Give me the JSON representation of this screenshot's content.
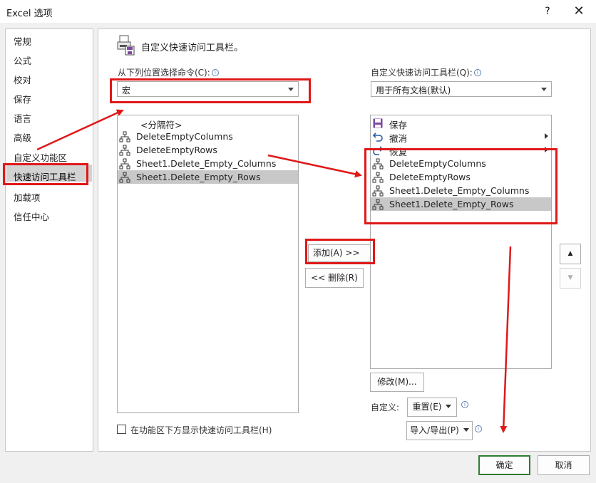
{
  "window": {
    "title": "Excel 选项",
    "help": "?",
    "close": "✕"
  },
  "nav": {
    "items": [
      "常规",
      "公式",
      "校对",
      "保存",
      "语言",
      "高级",
      "自定义功能区",
      "快速访问工具栏",
      "加载项",
      "信任中心"
    ],
    "selected_index": 7
  },
  "header": {
    "title": "自定义快速访问工具栏。"
  },
  "left": {
    "choose_label": "从下列位置选择命令(C):",
    "choose_value": "宏",
    "items": [
      {
        "label": "<分隔符>",
        "icon": "separator"
      },
      {
        "label": "DeleteEmptyColumns",
        "icon": "macro-icon"
      },
      {
        "label": "DeleteEmptyRows",
        "icon": "macro-icon"
      },
      {
        "label": "Sheet1.Delete_Empty_Columns",
        "icon": "macro-icon"
      },
      {
        "label": "Sheet1.Delete_Empty_Rows",
        "icon": "macro-icon"
      }
    ],
    "selected_index": 4,
    "checkbox_label": "在功能区下方显示快速访问工具栏(H)"
  },
  "middle": {
    "add": "添加(A) >>",
    "remove": "<< 删除(R)"
  },
  "right": {
    "customize_label": "自定义快速访问工具栏(Q):",
    "customize_value": "用于所有文档(默认)",
    "items": [
      {
        "label": "保存",
        "icon": "save-icon"
      },
      {
        "label": "撤消",
        "icon": "undo-icon",
        "submenu": true
      },
      {
        "label": "恢复",
        "icon": "redo-icon",
        "submenu": true
      },
      {
        "label": "DeleteEmptyColumns",
        "icon": "macro-icon"
      },
      {
        "label": "DeleteEmptyRows",
        "icon": "macro-icon"
      },
      {
        "label": "Sheet1.Delete_Empty_Columns",
        "icon": "macro-icon"
      },
      {
        "label": "Sheet1.Delete_Empty_Rows",
        "icon": "macro-icon"
      }
    ],
    "selected_index": 6,
    "modify": "修改(M)...",
    "custom_label": "自定义:",
    "reset": "重置(E)",
    "import_export": "导入/导出(P)",
    "move_up": "▲",
    "move_down": "▼"
  },
  "footer": {
    "ok": "确定",
    "cancel": "取消"
  },
  "colors": {
    "annotation": "#e01818",
    "ok_border": "#2f7d32",
    "selection": "#c8c8c8"
  }
}
